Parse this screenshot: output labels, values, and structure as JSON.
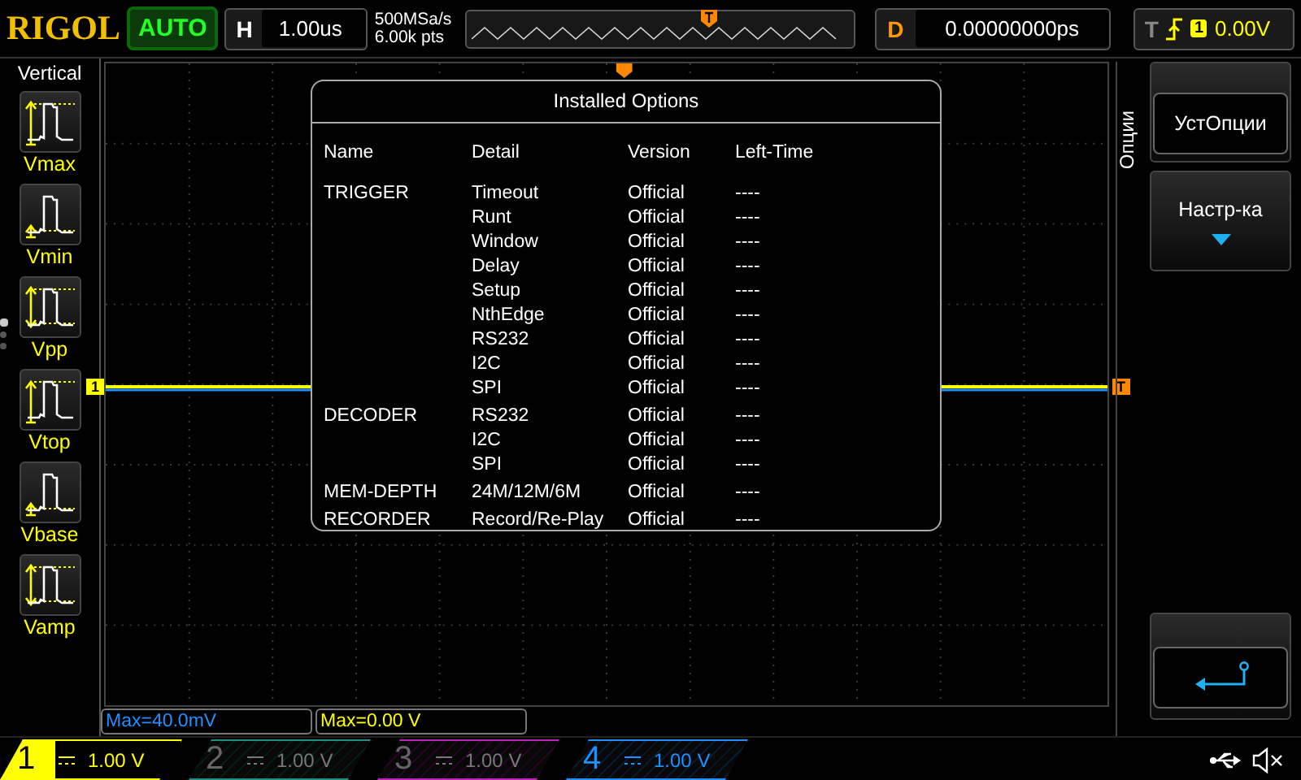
{
  "top_bar": {
    "logo": "RIGOL",
    "run_status": "AUTO",
    "horizontal": {
      "label": "H",
      "value": "1.00us"
    },
    "sample_rate": "500MSa/s",
    "memory_depth": "6.00k pts",
    "delay": {
      "label": "D",
      "value": "0.00000000ps"
    },
    "trigger": {
      "label": "T",
      "source": "1",
      "level": "0.00V"
    }
  },
  "sidebar": {
    "title": "Vertical",
    "pages": [
      {
        "selected": true
      },
      {
        "selected": false
      },
      {
        "selected": false
      }
    ],
    "items": [
      {
        "kind": "vmax",
        "label": "Vmax"
      },
      {
        "kind": "vmin",
        "label": "Vmin"
      },
      {
        "kind": "vpp",
        "label": "Vpp"
      },
      {
        "kind": "vtop",
        "label": "Vtop"
      },
      {
        "kind": "vbase",
        "label": "Vbase"
      },
      {
        "kind": "vamp",
        "label": "Vamp"
      }
    ]
  },
  "screen": {
    "channel_marker": "1",
    "trigger_marker": "T"
  },
  "dialog": {
    "title": "Installed Options",
    "columns": [
      "Name",
      "Detail",
      "Version",
      "Left-Time"
    ],
    "groups": [
      {
        "name": "TRIGGER",
        "items": [
          {
            "detail": "Timeout",
            "version": "Official",
            "left_time": "----"
          },
          {
            "detail": "Runt",
            "version": "Official",
            "left_time": "----"
          },
          {
            "detail": "Window",
            "version": "Official",
            "left_time": "----"
          },
          {
            "detail": "Delay",
            "version": "Official",
            "left_time": "----"
          },
          {
            "detail": "Setup",
            "version": "Official",
            "left_time": "----"
          },
          {
            "detail": "NthEdge",
            "version": "Official",
            "left_time": "----"
          },
          {
            "detail": "RS232",
            "version": "Official",
            "left_time": "----"
          },
          {
            "detail": "I2C",
            "version": "Official",
            "left_time": "----"
          },
          {
            "detail": "SPI",
            "version": "Official",
            "left_time": "----"
          }
        ]
      },
      {
        "name": "DECODER",
        "items": [
          {
            "detail": "RS232",
            "version": "Official",
            "left_time": "----"
          },
          {
            "detail": "I2C",
            "version": "Official",
            "left_time": "----"
          },
          {
            "detail": "SPI",
            "version": "Official",
            "left_time": "----"
          }
        ]
      },
      {
        "name": "MEM-DEPTH",
        "items": [
          {
            "detail": "24M/12M/6M",
            "version": "Official",
            "left_time": "----"
          }
        ]
      },
      {
        "name": "RECORDER",
        "items": [
          {
            "detail": "Record/Re-Play",
            "version": "Official",
            "left_time": "----"
          }
        ]
      }
    ]
  },
  "measurements": [
    {
      "text": "Max=40.0mV",
      "color": "#1e90ff"
    },
    {
      "text": "Max=0.00 V",
      "color": "#ffff00"
    }
  ],
  "menu": {
    "title": "Опции",
    "items": [
      {
        "kind": "button",
        "label": "УстОпции"
      },
      {
        "kind": "dropdown",
        "label": "Настр-ка"
      },
      {
        "kind": "back"
      }
    ]
  },
  "channels": [
    {
      "number": "1",
      "scale": "1.00 V",
      "color": "#ffff00",
      "on": true,
      "selected": true
    },
    {
      "number": "2",
      "scale": "1.00 V",
      "color": "#1a9080",
      "on": false,
      "selected": false
    },
    {
      "number": "3",
      "scale": "1.00 V",
      "color": "#c020c0",
      "on": false,
      "selected": false
    },
    {
      "number": "4",
      "scale": "1.00 V",
      "color": "#1e90ff",
      "on": true,
      "selected": false
    }
  ]
}
